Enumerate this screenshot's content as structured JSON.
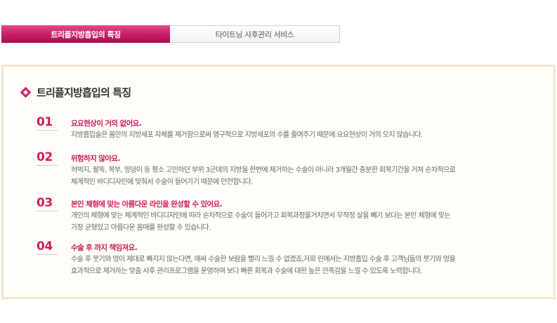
{
  "tabs": [
    {
      "label": "트리플지방흡입의 특징",
      "active": true
    },
    {
      "label": "타이트닝 사후관리 서비스",
      "active": false
    }
  ],
  "panel": {
    "title": "트리플지방흡입의 특징",
    "items": [
      {
        "number": "01",
        "heading": "요요현상이 거의 없어요.",
        "lines": [
          "지방흡입술은 몸안의 지방세포 자체를 제거함으로써 영구적으로 지방세포의 수를 줄여주기 때문에 요요현상이 거의 오지 않습니다."
        ]
      },
      {
        "number": "02",
        "heading": "위험하지 않아요.",
        "lines": [
          "허벅지, 팔뚝, 복부, 엉덩이 등 평소 고민하던 부위 3군데의 지방을 한번에 제거하는 수술이 아니라 3개월간 충분한 회복기간을 거쳐 순차적으로",
          "체계적인 바디디자인에 맞춰서 수술이 들어가기 때문에 안전합니다."
        ]
      },
      {
        "number": "03",
        "heading": "본인 체형에 맞는 아름다운 라인을 완성할 수 있어요.",
        "lines": [
          "개인의 체형에 맞는 체계적인 바디디자인에 따라 순차적으로 수술이 들어가고 회복과정을거치면서 무작정 살을 빼기 보다는 본인 체형에 맞는",
          "가장 균형있고 아름다운 몸매를 완성할 수 있습니다."
        ]
      },
      {
        "number": "04",
        "heading": "수술 후 까지 책임져요.",
        "lines": [
          "수술 후 붓기와 멍이 제대로 빠지지 않는다면, 애써 수술한 보람을 빨리 느낄 수 없겠죠,저희 린에서는 지방흡입 수술 후 고객님들의 붓기와 멍을",
          "효과적으로 제거하는 맞춤 사후 관리프로그램을 운영하여 보다 빠른 회복과 수술에 대한 높은 만족감을 느낄 수 있도록 노력합니다."
        ]
      }
    ]
  },
  "colors": {
    "accent": "#cf1c5e",
    "panel_bg": "#fffdf7",
    "panel_border": "#f4e6d2"
  }
}
